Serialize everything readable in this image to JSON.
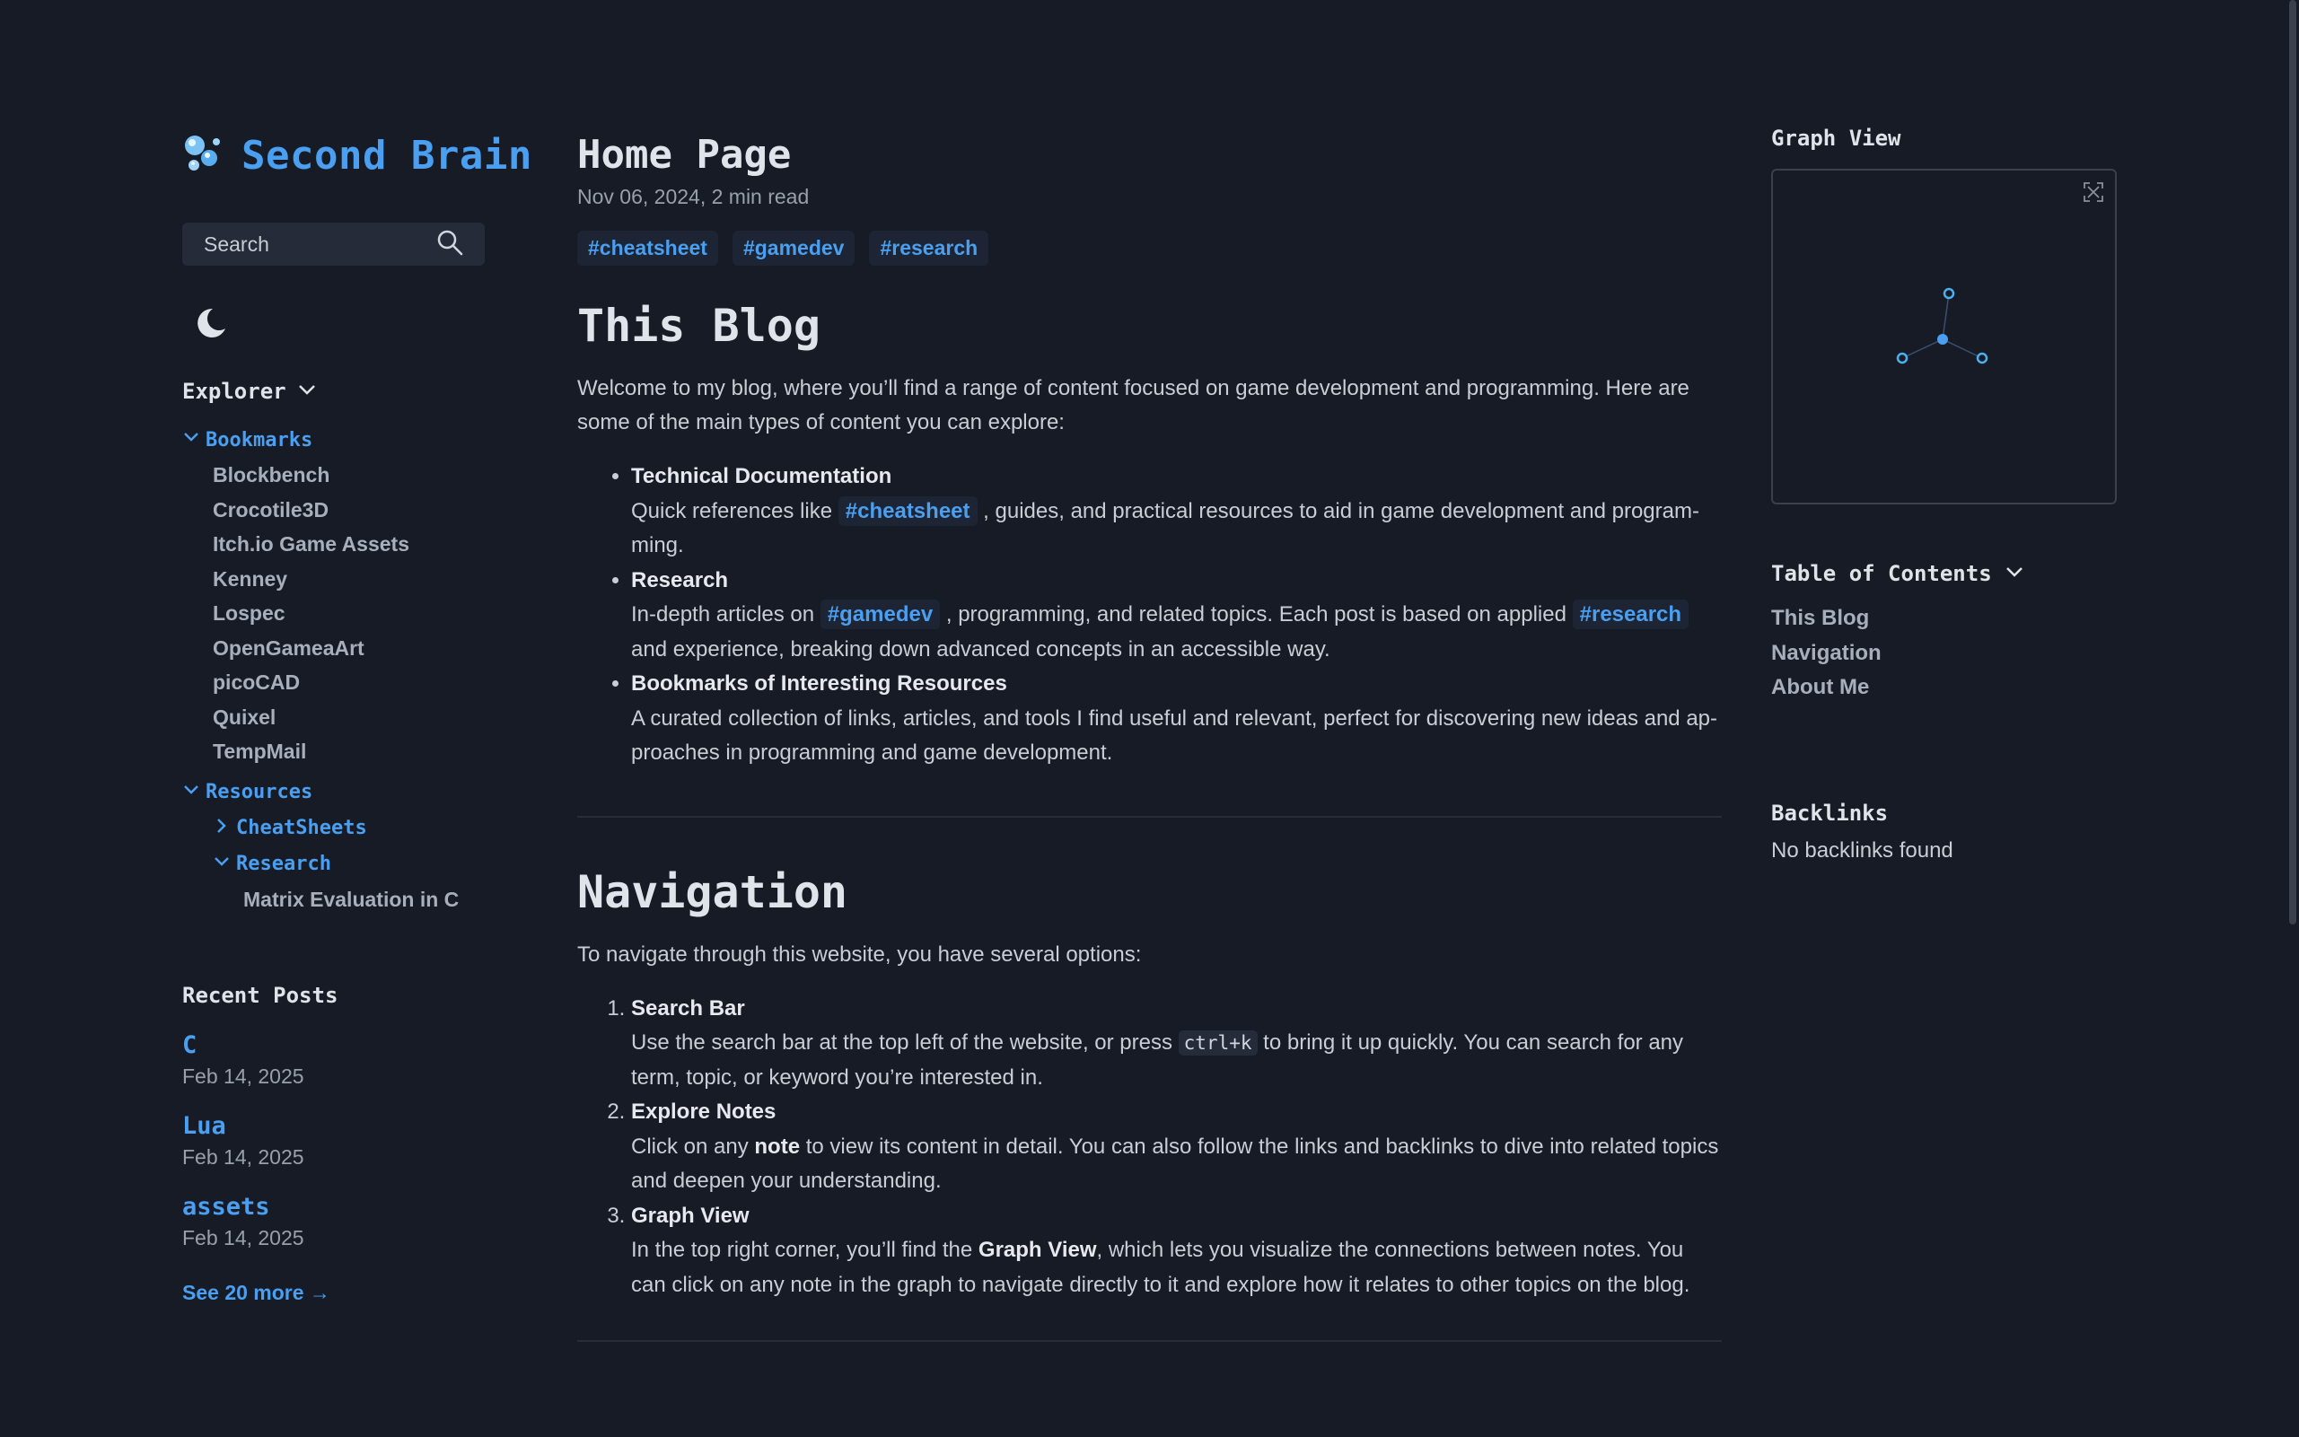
{
  "brand": {
    "title": "Second Brain",
    "logo_icon": "bubbles-icon"
  },
  "search": {
    "label": "Search"
  },
  "explorer": {
    "title": "Explorer",
    "bookmarks": {
      "label": "Bookmarks",
      "items": [
        "Blockbench",
        "Crocotile3D",
        "Itch.io Game Assets",
        "Kenney",
        "Lospec",
        "OpenGameaArt",
        "picoCAD",
        "Quixel",
        "TempMail"
      ]
    },
    "resources": {
      "label": "Resources"
    },
    "cheatsheets": {
      "label": "CheatSheets"
    },
    "research": {
      "label": "Research",
      "items": [
        "Matrix Evaluation in C"
      ]
    }
  },
  "recent": {
    "title": "Recent Posts",
    "items": [
      {
        "title": "C",
        "date": "Feb 14, 2025"
      },
      {
        "title": "Lua",
        "date": "Feb 14, 2025"
      },
      {
        "title": "assets",
        "date": "Feb 14, 2025"
      }
    ],
    "see_more": "See 20 more →"
  },
  "page": {
    "title": "Home Page",
    "meta": "Nov 06, 2024,  2 min read",
    "tags": [
      "#cheatsheet",
      "#gamedev",
      "#research"
    ]
  },
  "blog": {
    "heading": "This Blog",
    "intro": "Welcome to my blog, where you’ll find a range of content focused on game development and programming. Here are some of the main types of content you can explore:",
    "items": [
      {
        "head": "Technical Documentation",
        "pre": "Quick references like ",
        "tag": "#cheatsheet",
        "post": " , guides, and practical resources to aid in game development and program­ming."
      },
      {
        "head": "Research",
        "pre": "In-depth articles on ",
        "tag": "#gamedev",
        "mid": " , programming, and related topics. Each post is based on applied ",
        "tag2": "#research",
        "post": "  and experience, breaking down advanced concepts in an accessible way."
      },
      {
        "head": "Bookmarks of Interesting Resources",
        "text": "A curated collection of links, articles, and tools I find useful and relevant, perfect for discovering new ideas and ap­proaches in programming and game development."
      }
    ]
  },
  "nav": {
    "heading": "Navigation",
    "intro": "To navigate through this website, you have several options:",
    "items": [
      {
        "head": "Search Bar",
        "pre": "Use the search bar at the top left of the website, or press ",
        "kbd": "ctrl+k",
        "post": " to bring it up quickly. You can search for any term, topic, or keyword you’re interested in."
      },
      {
        "head": "Explore Notes",
        "pre": "Click on any ",
        "bold": "note",
        "post": " to view its content in detail. You can also follow the links and backlinks to dive into related topics and deepen your understanding."
      },
      {
        "head": "Graph View",
        "pre": "In the top right corner, you’ll find the ",
        "bold": "Graph View",
        "post": ", which lets you visualize the connections between notes. You can click on any note in the graph to navigate directly to it and explore how it relates to other topics on the blog."
      }
    ]
  },
  "graph": {
    "title": "Graph View"
  },
  "toc": {
    "title": "Table of Contents",
    "items": [
      "This Blog",
      "Navigation",
      "About Me"
    ]
  },
  "backlinks": {
    "title": "Backlinks",
    "empty": "No backlinks found"
  },
  "colors": {
    "bg": "#161b26",
    "accent": "#4a9ff0",
    "text": "#d2d6de"
  }
}
